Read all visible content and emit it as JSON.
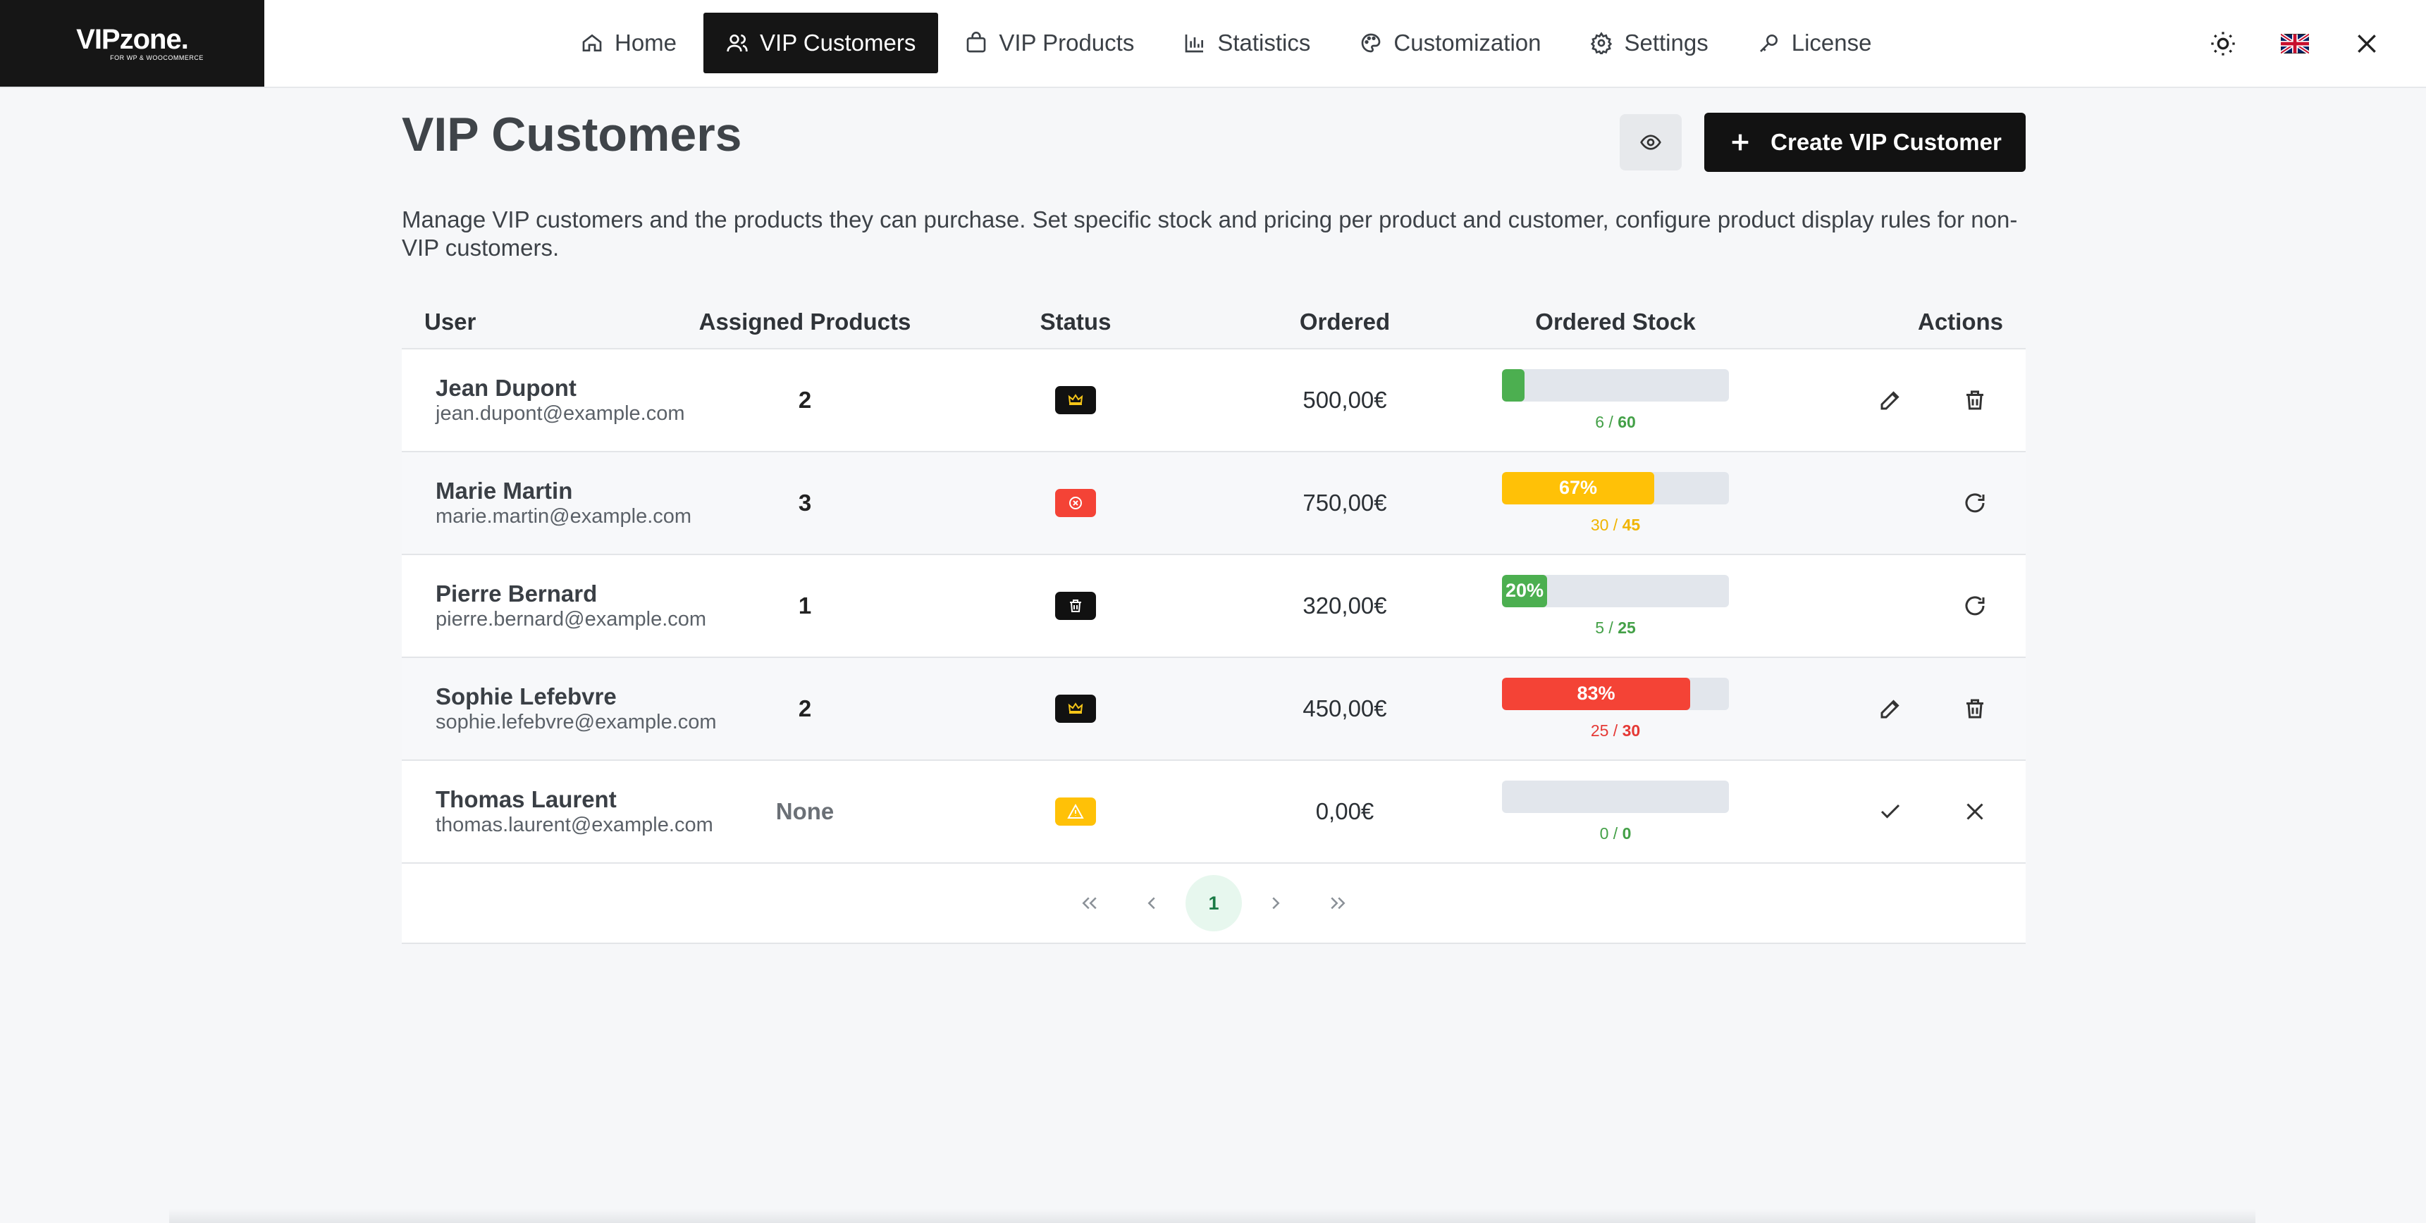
{
  "app": {
    "logo_text": "VIPzone.",
    "logo_sub": "FOR WP & WOOCOMMERCE"
  },
  "nav": {
    "items": [
      {
        "label": "Home",
        "icon": "home-icon"
      },
      {
        "label": "VIP Customers",
        "icon": "users-icon",
        "active": true
      },
      {
        "label": "VIP Products",
        "icon": "shopping-bag-icon"
      },
      {
        "label": "Statistics",
        "icon": "bar-chart-icon"
      },
      {
        "label": "Customization",
        "icon": "palette-icon"
      },
      {
        "label": "Settings",
        "icon": "gear-icon"
      },
      {
        "label": "License",
        "icon": "key-icon"
      }
    ]
  },
  "page": {
    "title": "VIP Customers",
    "create_label": "Create VIP Customer",
    "description": "Manage VIP customers and the products they can purchase. Set specific stock and pricing per product and customer, configure product display rules for non-VIP customers."
  },
  "table": {
    "headers": {
      "user": "User",
      "assigned": "Assigned Products",
      "status": "Status",
      "ordered": "Ordered",
      "stock": "Ordered Stock",
      "actions": "Actions"
    },
    "rows": [
      {
        "name": "Jean Dupont",
        "email": "jean.dupont@example.com",
        "assigned": "2",
        "status": "crown-icon",
        "status_color": "#111111",
        "status_icon_color": "#f5c518",
        "ordered": "500,00€",
        "stock_label": "",
        "stock_ordered": "6",
        "stock_total": "60",
        "stock_fraction": 0.1,
        "bar_color": "#4caf50",
        "caption_color": "#43a047",
        "actions": [
          "edit-icon",
          "trash-icon"
        ]
      },
      {
        "name": "Marie Martin",
        "email": "marie.martin@example.com",
        "assigned": "3",
        "status": "x-circle-icon",
        "status_color": "#f44336",
        "status_icon_color": "#ffffff",
        "ordered": "750,00€",
        "stock_label": "67%",
        "stock_ordered": "30",
        "stock_total": "45",
        "stock_fraction": 0.67,
        "bar_color": "#ffc107",
        "caption_color": "#f0b400",
        "actions": [
          "refresh-icon"
        ]
      },
      {
        "name": "Pierre Bernard",
        "email": "pierre.bernard@example.com",
        "assigned": "1",
        "status": "trash-icon",
        "status_color": "#111111",
        "status_icon_color": "#ffffff",
        "ordered": "320,00€",
        "stock_label": "20%",
        "stock_ordered": "5",
        "stock_total": "25",
        "stock_fraction": 0.2,
        "bar_color": "#4caf50",
        "caption_color": "#43a047",
        "actions": [
          "refresh-icon"
        ]
      },
      {
        "name": "Sophie Lefebvre",
        "email": "sophie.lefebvre@example.com",
        "assigned": "2",
        "status": "crown-icon",
        "status_color": "#111111",
        "status_icon_color": "#f5c518",
        "ordered": "450,00€",
        "stock_label": "83%",
        "stock_ordered": "25",
        "stock_total": "30",
        "stock_fraction": 0.83,
        "bar_color": "#f44336",
        "caption_color": "#e53935",
        "actions": [
          "edit-icon",
          "trash-icon"
        ]
      },
      {
        "name": "Thomas Laurent",
        "email": "thomas.laurent@example.com",
        "assigned": "None",
        "status": "warning-icon",
        "status_color": "#ffc107",
        "status_icon_color": "#ffffff",
        "ordered": "0,00€",
        "stock_label": "",
        "stock_ordered": "0",
        "stock_total": "0",
        "stock_fraction": 0,
        "bar_color": "#4caf50",
        "caption_color": "#43a047",
        "actions": [
          "check-icon",
          "close-icon"
        ]
      }
    ]
  },
  "pagination": {
    "current": "1"
  }
}
